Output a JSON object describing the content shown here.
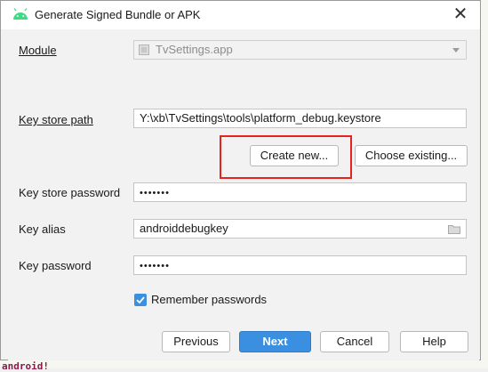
{
  "dialog": {
    "title": "Generate Signed Bundle or APK",
    "close_symbol": "✕"
  },
  "form": {
    "module_label": "Module",
    "module_value": "TvSettings.app",
    "key_store_path_label": "Key store path",
    "key_store_path_value": "Y:\\xb\\TvSettings\\tools\\platform_debug.keystore",
    "create_new_label": "Create new...",
    "choose_existing_label": "Choose existing...",
    "key_store_password_label": "Key store password",
    "key_store_password_mask": "•••••••",
    "key_alias_label": "Key alias",
    "key_alias_value": "androiddebugkey",
    "key_password_label": "Key password",
    "key_password_mask": "•••••••",
    "remember_passwords_label": "Remember passwords",
    "remember_passwords_checked": true
  },
  "footer": {
    "previous_label": "Previous",
    "next_label": "Next",
    "cancel_label": "Cancel",
    "help_label": "Help"
  },
  "background": {
    "bottom_text": "android!"
  },
  "colors": {
    "accent": "#3a8fe0",
    "highlight_box": "#e8231e",
    "android_green": "#3ddc84"
  },
  "icons": [
    "android-icon",
    "module-icon",
    "dropdown-arrow-icon",
    "folder-icon",
    "checkmark-icon",
    "close-icon"
  ]
}
